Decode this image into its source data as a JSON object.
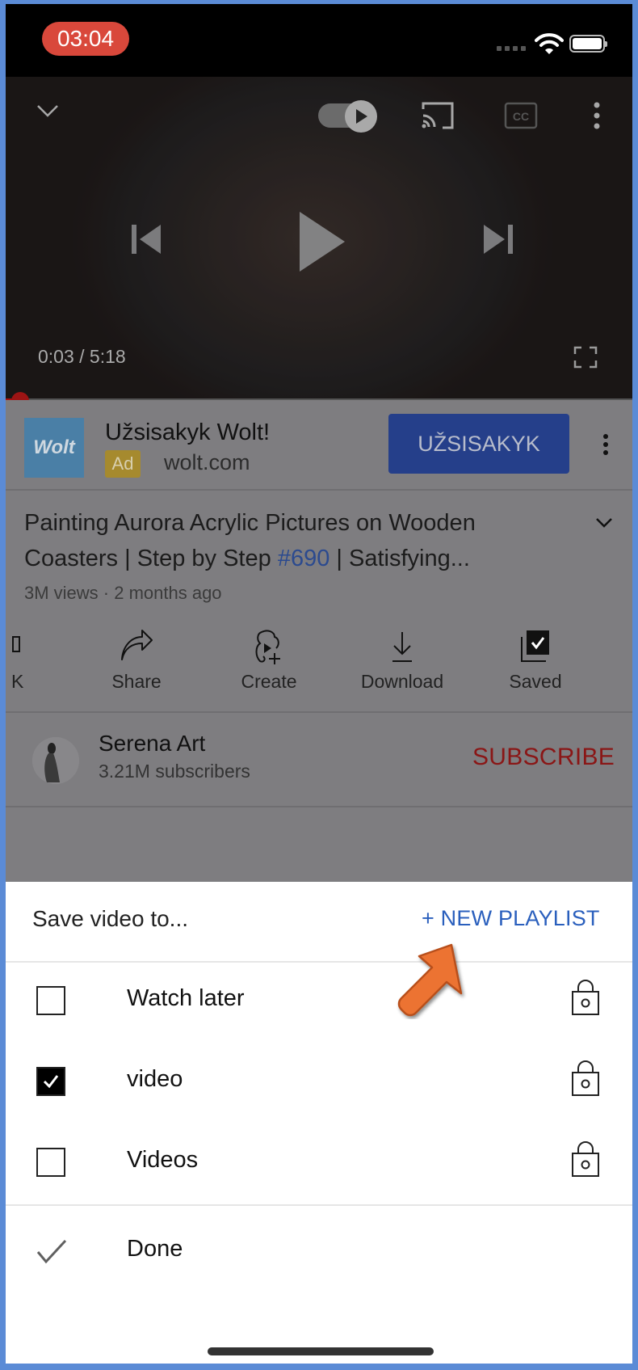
{
  "status_bar": {
    "time": "03:04",
    "icons": [
      "cellular-dots-icon",
      "wifi-icon",
      "battery-icon"
    ]
  },
  "player": {
    "controls": [
      "chevron-down-icon",
      "autoplay-toggle-icon",
      "cast-icon",
      "captions-icon",
      "more-vert-icon",
      "previous-icon",
      "play-icon",
      "next-icon",
      "fullscreen-icon"
    ],
    "current_time": "0:03",
    "duration": "5:18",
    "time_readout": "0:03 / 5:18",
    "progress_fraction": 0.01,
    "autoplay_on": true
  },
  "ad": {
    "logo_text": "Wolt",
    "title": "Užsisakyk Wolt!",
    "badge": "Ad",
    "domain": "wolt.com",
    "cta_label": "UŽSISAKYK"
  },
  "video": {
    "title_part1": "Painting Aurora Acrylic Pictures on Wooden Coasters | Step by Step ",
    "title_hashtag": "#690",
    "title_part2": " | Satisfying...",
    "meta": "3M views · 2 months ago"
  },
  "actions": [
    {
      "label": "K",
      "icon": "dislike-icon"
    },
    {
      "label": "Share",
      "icon": "share-icon"
    },
    {
      "label": "Create",
      "icon": "create-icon"
    },
    {
      "label": "Download",
      "icon": "download-icon"
    },
    {
      "label": "Saved",
      "icon": "saved-icon"
    }
  ],
  "channel": {
    "name": "Serena Art",
    "subscribers": "3.21M subscribers",
    "subscribe_label": "SUBSCRIBE"
  },
  "save_sheet": {
    "title": "Save video to...",
    "new_playlist_label": "+ NEW PLAYLIST",
    "playlists": [
      {
        "name": "Watch later",
        "checked": false,
        "privacy": "private"
      },
      {
        "name": "video",
        "checked": true,
        "privacy": "private"
      },
      {
        "name": "Videos",
        "checked": false,
        "privacy": "private"
      }
    ],
    "done_label": "Done"
  },
  "colors": {
    "accent_blue": "#2a5fbd",
    "subscribe_red": "#8a1616",
    "time_pill": "#d9483b",
    "annotation_arrow": "#ec7332",
    "frame_border": "#5b8bd6"
  }
}
